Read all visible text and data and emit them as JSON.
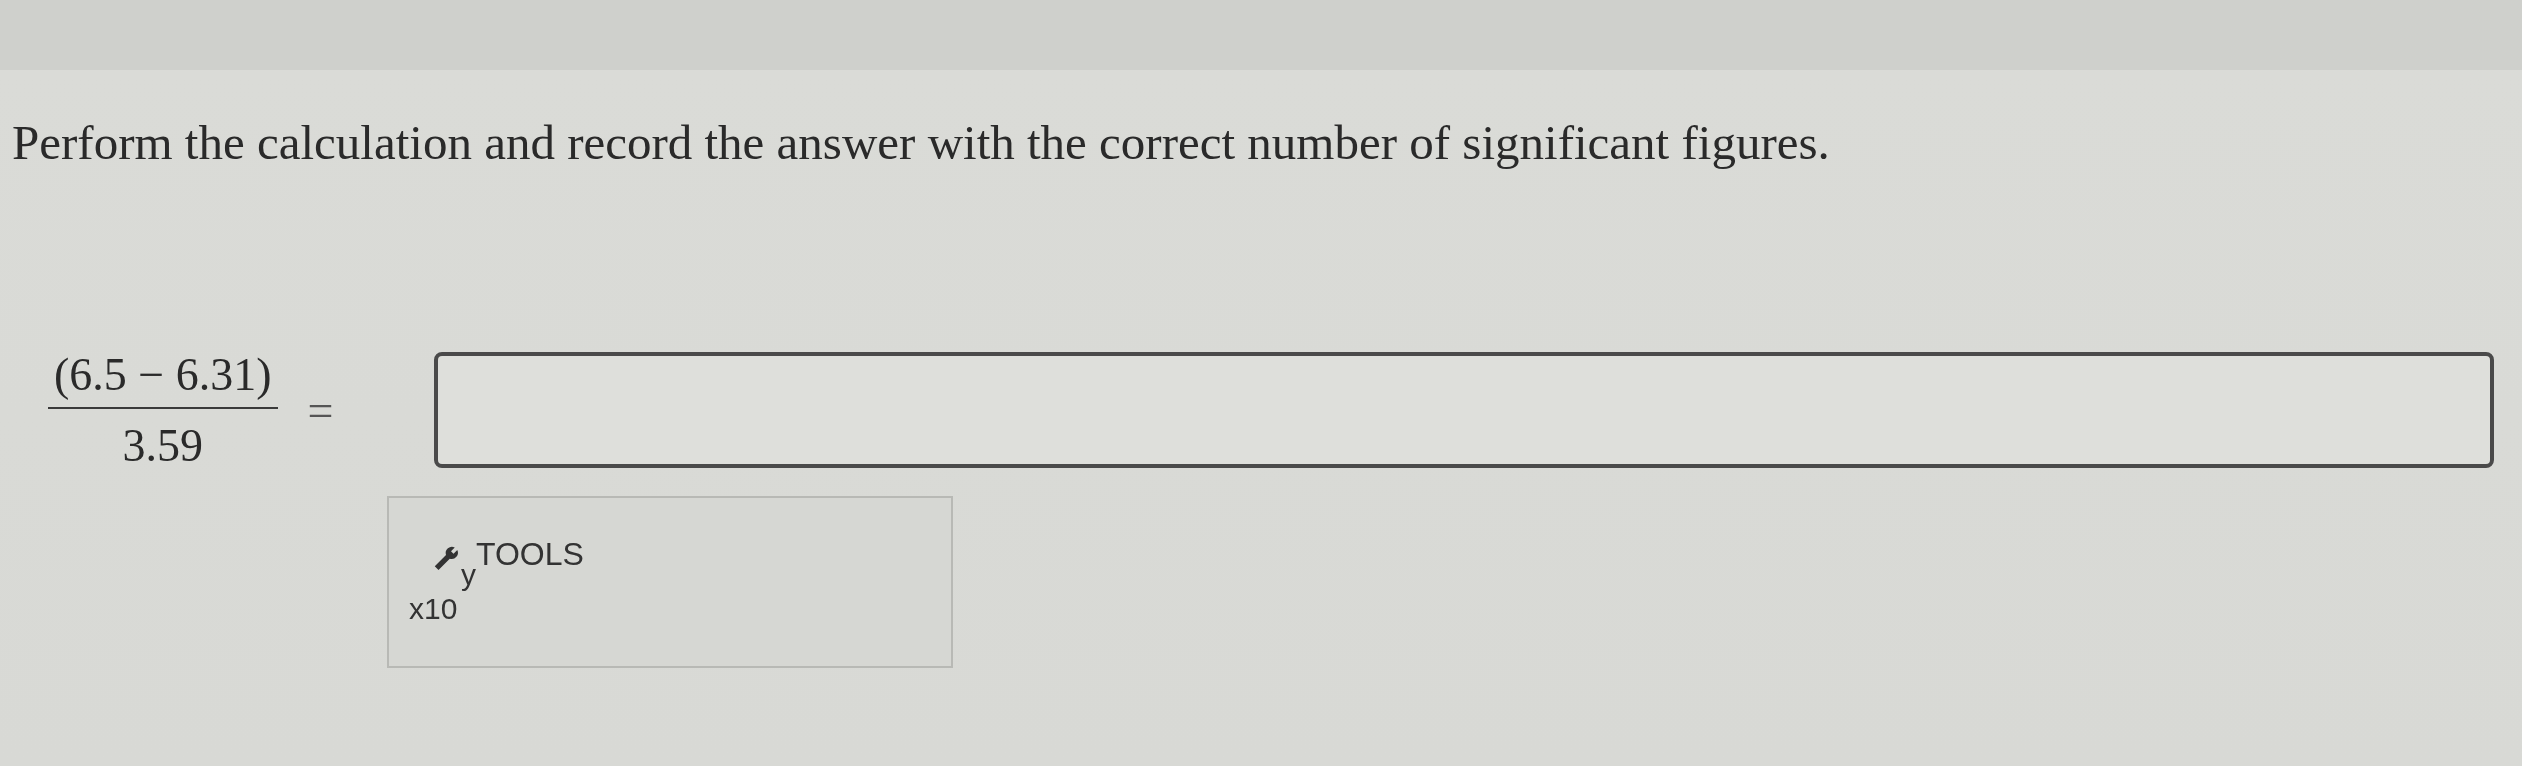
{
  "question": {
    "prompt": "Perform the calculation and record the answer with the correct number of significant figures."
  },
  "expression": {
    "numerator": "(6.5 − 6.31)",
    "denominator": "3.59",
    "equals": "="
  },
  "tools_panel": {
    "label": "TOOLS",
    "keys": [
      "y",
      "x10"
    ]
  }
}
